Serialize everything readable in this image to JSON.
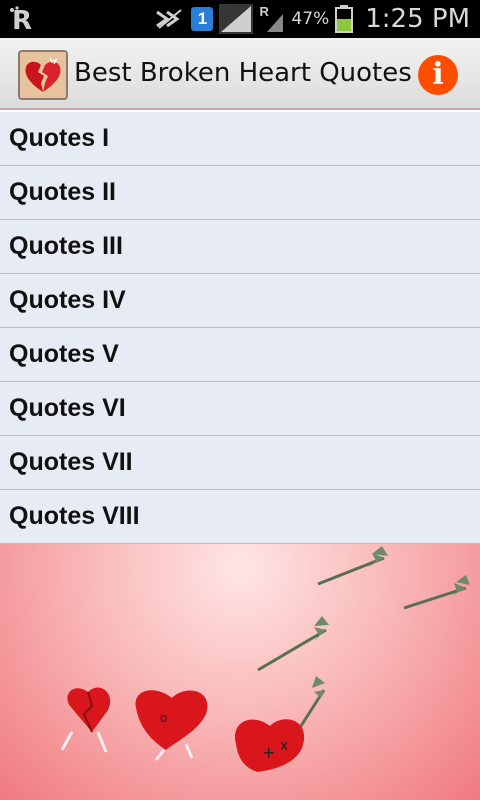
{
  "status_bar": {
    "battery_percent": "47%",
    "time": "1:25 PM",
    "sim_badge": "1",
    "network_letter": "R",
    "icons": [
      "app-r-icon",
      "no-signal-icon",
      "sim-icon",
      "signal-icon",
      "roaming-signal-icon",
      "battery-icon"
    ]
  },
  "action_bar": {
    "title": "Best Broken Heart Quotes",
    "info_label": "i",
    "icons": [
      "broken-heart-app-icon",
      "info-icon"
    ]
  },
  "list": {
    "items": [
      {
        "label": "Quotes I"
      },
      {
        "label": "Quotes II"
      },
      {
        "label": "Quotes III"
      },
      {
        "label": "Quotes IV"
      },
      {
        "label": "Quotes V"
      },
      {
        "label": "Quotes VI"
      },
      {
        "label": "Quotes VII"
      },
      {
        "label": "Quotes VIII"
      }
    ]
  },
  "colors": {
    "accent": "#ff4d00",
    "list_background": "#e7ecf4",
    "divider": "#d8b0b0",
    "heart_red": "#d8161b"
  }
}
